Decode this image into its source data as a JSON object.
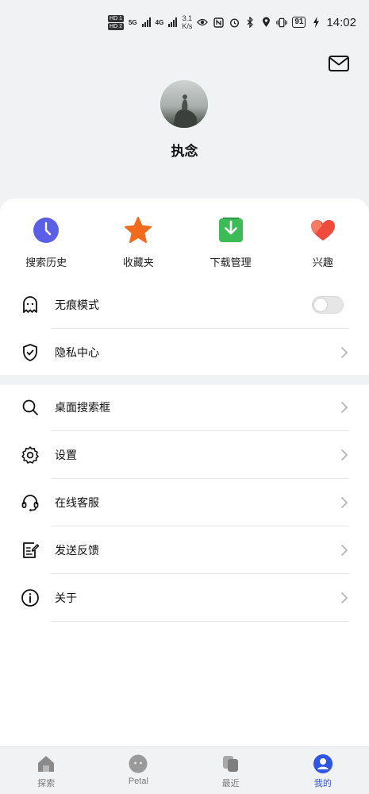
{
  "status_bar": {
    "hd1": "HD 1",
    "hd2": "HD 2",
    "net1": "5G",
    "net2": "4G",
    "speed_value": "3.1",
    "speed_unit": "K/s",
    "battery": "91",
    "time": "14:02"
  },
  "profile": {
    "username": "执念"
  },
  "quick_actions": [
    {
      "label": "搜索历史",
      "icon": "clock-icon",
      "color": "#5b5fe6"
    },
    {
      "label": "收藏夹",
      "icon": "star-icon",
      "color": "#f26b1d"
    },
    {
      "label": "下载管理",
      "icon": "download-icon",
      "color": "#3dbb57"
    },
    {
      "label": "兴趣",
      "icon": "heart-icon",
      "color": "#ef4a3c"
    }
  ],
  "settings_group1": [
    {
      "label": "无痕模式",
      "icon": "ghost-icon",
      "control": "toggle",
      "toggle_on": false
    },
    {
      "label": "隐私中心",
      "icon": "shield-check-icon",
      "control": "chevron"
    }
  ],
  "settings_group2": [
    {
      "label": "桌面搜索框",
      "icon": "search-icon"
    },
    {
      "label": "设置",
      "icon": "gear-icon"
    },
    {
      "label": "在线客服",
      "icon": "headset-icon"
    },
    {
      "label": "发送反馈",
      "icon": "feedback-edit-icon"
    },
    {
      "label": "关于",
      "icon": "info-icon"
    }
  ],
  "bottom_nav": [
    {
      "label": "探索",
      "icon": "home-icon",
      "active": false
    },
    {
      "label": "Petal",
      "icon": "petal-face-icon",
      "active": false
    },
    {
      "label": "最近",
      "icon": "recent-cards-icon",
      "active": false
    },
    {
      "label": "我的",
      "icon": "profile-icon",
      "active": true
    }
  ],
  "colors": {
    "background": "#f1f2f4",
    "card": "#ffffff",
    "accent": "#2f55e4"
  }
}
